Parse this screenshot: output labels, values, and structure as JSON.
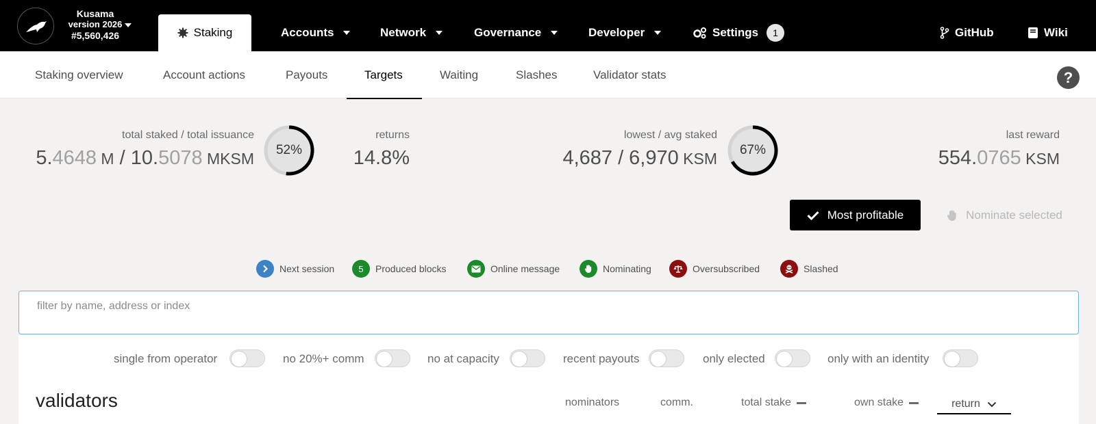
{
  "chain": {
    "name": "Kusama",
    "version": "version 2026",
    "block": "#5,560,426"
  },
  "topnav": {
    "active_tab": "Staking",
    "menu": [
      "Accounts",
      "Network",
      "Governance",
      "Developer"
    ],
    "settings_label": "Settings",
    "settings_badge": "1",
    "github_label": "GitHub",
    "wiki_label": "Wiki"
  },
  "subnav": {
    "items": [
      "Staking overview",
      "Account actions",
      "Payouts",
      "Targets",
      "Waiting",
      "Slashes",
      "Validator stats"
    ],
    "active": "Targets"
  },
  "summary": {
    "total_label": "total staked / total issuance",
    "total_staked_int": "5.",
    "total_staked_dec": "4648",
    "total_staked_unit": " M",
    "sep": " / ",
    "total_issuance_int": "10.",
    "total_issuance_dec": "5078",
    "total_issuance_unit": " MKSM",
    "staked_percent": "52%",
    "staked_fraction": 0.52,
    "returns_label": "returns",
    "returns_value": "14.8%",
    "lowavg_label": "lowest / avg staked",
    "lowavg_value": "4,687 / 6,970",
    "lowavg_unit": " KSM",
    "lowavg_percent": "67%",
    "lowavg_fraction": 0.67,
    "reward_label": "last reward",
    "reward_int": "554.",
    "reward_dec": "0765",
    "reward_unit": " KSM"
  },
  "actions": {
    "most_profitable": "Most profitable",
    "nominate_selected": "Nominate selected"
  },
  "legend": [
    {
      "label": "Next session",
      "icon": "chevron-right-icon",
      "color": "#3d82c4"
    },
    {
      "label": "Produced blocks",
      "icon": "5",
      "color": "#1b8a2a"
    },
    {
      "label": "Online message",
      "icon": "envelope-icon",
      "color": "#1b8a2a"
    },
    {
      "label": "Nominating",
      "icon": "hand-icon",
      "color": "#1b8a2a"
    },
    {
      "label": "Oversubscribed",
      "icon": "balance-scale-icon",
      "color": "#8b0f0f"
    },
    {
      "label": "Slashed",
      "icon": "skull-crossbones-icon",
      "color": "#8b0f0f"
    }
  ],
  "filter": {
    "placeholder": "filter by name, address or index"
  },
  "toggles": [
    "single from operator",
    "no 20%+ comm",
    "no at capacity",
    "recent payouts",
    "only elected",
    "only with an identity"
  ],
  "table": {
    "title": "validators",
    "columns": [
      "nominators",
      "comm.",
      "total stake",
      "own stake"
    ],
    "sort_value": "return"
  },
  "colors": {
    "accent": "#000000",
    "legend_blue": "#3d82c4",
    "legend_green": "#1b8a2a",
    "legend_red": "#8b0f0f"
  }
}
